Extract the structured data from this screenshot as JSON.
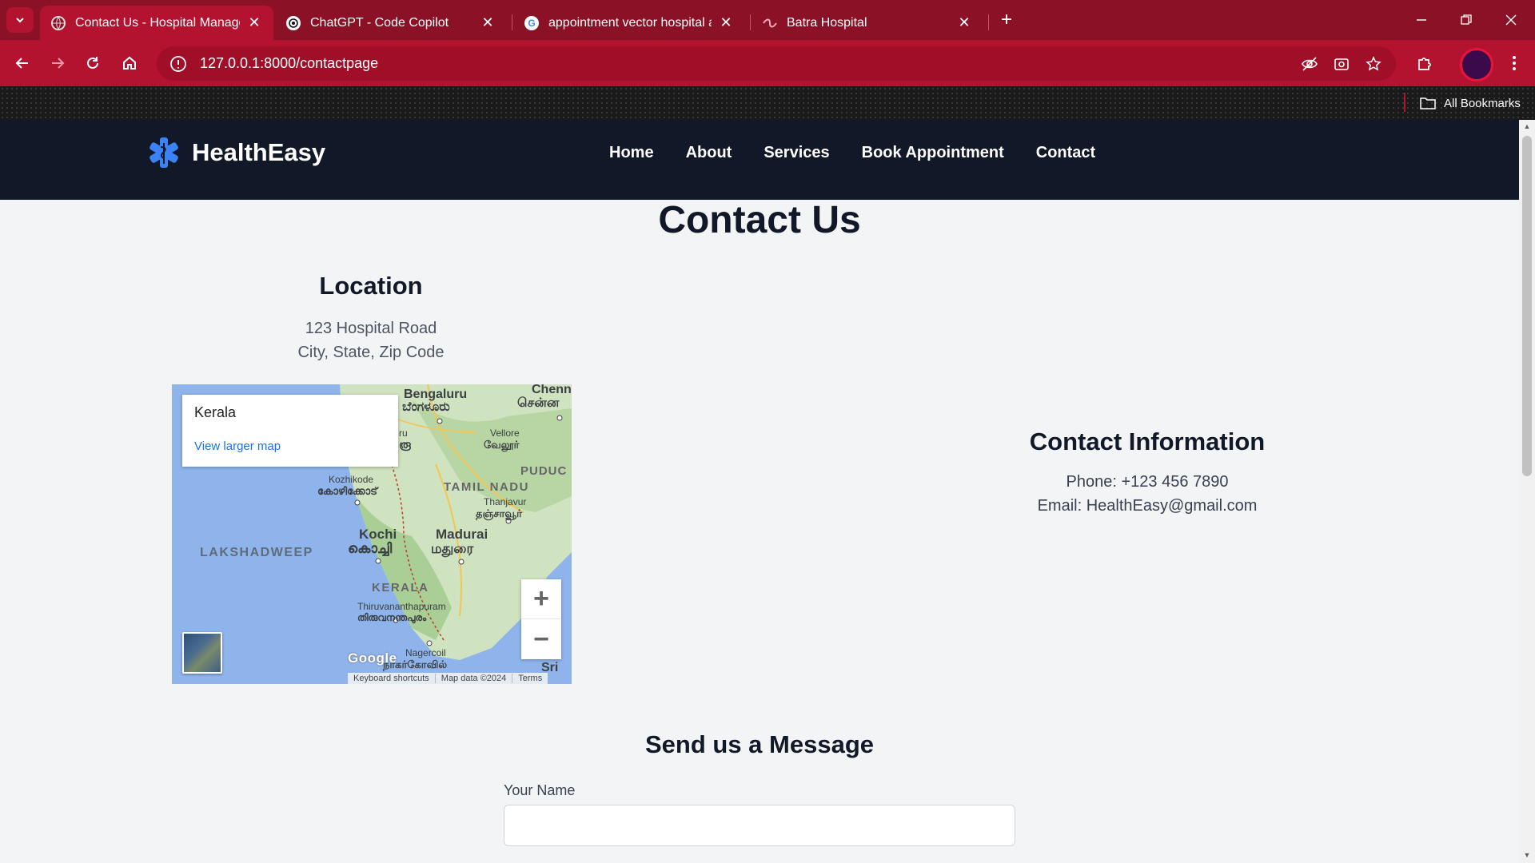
{
  "browser": {
    "tabs": [
      {
        "title": "Contact Us - Hospital Management",
        "active": true
      },
      {
        "title": "ChatGPT - Code Copilot",
        "active": false
      },
      {
        "title": "appointment vector hospital appointment",
        "active": false
      },
      {
        "title": "Batra Hospital",
        "active": false
      }
    ],
    "url": "127.0.0.1:8000/contactpage",
    "all_bookmarks": "All Bookmarks",
    "accent_color": "#b3132e",
    "tabbar_color": "#8b1126"
  },
  "site": {
    "brand": "HealthEasy",
    "nav": [
      "Home",
      "About",
      "Services",
      "Book Appointment",
      "Contact"
    ],
    "nav_color": "#111827"
  },
  "page": {
    "title": "Contact Us",
    "location": {
      "heading": "Location",
      "address_line1": "123 Hospital Road",
      "address_line2": "City, State, Zip Code"
    },
    "map": {
      "place": "Kerala",
      "view_larger": "View larger map",
      "labels": {
        "bengaluru": "Bengaluru",
        "bengaluru_local": "ಬೆಂಗಳೂರು",
        "chennai": "Chenn",
        "chennai_local": "சென்ன",
        "vellore": "Vellore",
        "vellore_local": "வேலூர்",
        "puducherry": "PUDUC",
        "tamil_nadu": "TAMIL NADU",
        "kozhikode": "Kozhikode",
        "kozhikode_local": "കോഴിക്കോട്",
        "thanjavur": "Thanjavur",
        "thanjavur_local": "தஞ்சாவூர்",
        "kochi": "Kochi",
        "kochi_local": "കൊച്ചി",
        "madurai": "Madurai",
        "madurai_local": "மதுரை",
        "lakshadweep": "LAKSHADWEEP",
        "kerala": "KERALA",
        "trivandrum": "Thiruvananthapuram",
        "trivandrum_local": "തിരുവനന്തപുരം",
        "nagercoil": "Nagercoil",
        "nagercoil_local": "நாகர்கோவில்",
        "sri": "Sri",
        "mysuru_fragment": "ru",
        "mysuru_fragment_local": "രൂ"
      },
      "google": "Google",
      "footer": [
        "Keyboard shortcuts",
        "Map data ©2024",
        "Terms"
      ],
      "zoom_in": "+",
      "zoom_out": "−"
    },
    "contact": {
      "heading": "Contact Information",
      "phone": "Phone: +123 456 7890",
      "email": "Email: HealthEasy@gmail.com"
    },
    "message": {
      "heading": "Send us a Message",
      "name_label": "Your Name",
      "name_value": ""
    }
  }
}
